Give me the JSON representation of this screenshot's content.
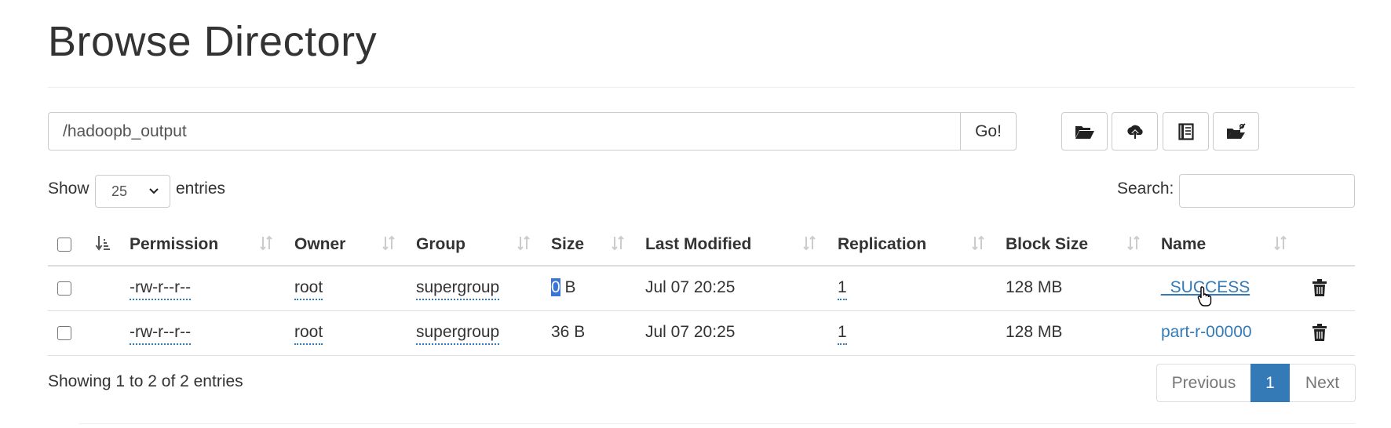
{
  "page": {
    "title": "Browse Directory"
  },
  "pathbar": {
    "value": "/hadoopb_output",
    "go_label": "Go!"
  },
  "toolbar": {
    "icons": [
      "folder-open-icon",
      "cloud-upload-icon",
      "book-icon",
      "cut-paste-icon"
    ]
  },
  "length": {
    "show_label": "Show",
    "selected": "25",
    "entries_label": "entries"
  },
  "search": {
    "label": "Search:",
    "value": ""
  },
  "table": {
    "headers": {
      "permission": "Permission",
      "owner": "Owner",
      "group": "Group",
      "size": "Size",
      "last_modified": "Last Modified",
      "replication": "Replication",
      "block_size": "Block Size",
      "name": "Name"
    },
    "rows": [
      {
        "permission": "-rw-r--r--",
        "owner": "root",
        "group": "supergroup",
        "size_num": "0",
        "size_unit": " B",
        "last_modified": "Jul 07 20:25",
        "replication": "1",
        "block_size": "128 MB",
        "name": "_SUCCESS"
      },
      {
        "permission": "-rw-r--r--",
        "owner": "root",
        "group": "supergroup",
        "size": "36 B",
        "last_modified": "Jul 07 20:25",
        "replication": "1",
        "block_size": "128 MB",
        "name": "part-r-00000"
      }
    ]
  },
  "footer": {
    "info": "Showing 1 to 2 of 2 entries",
    "pagination": {
      "previous": "Previous",
      "current": "1",
      "next": "Next"
    }
  },
  "colors": {
    "link": "#337ab7",
    "active_page": "#337ab7",
    "text_highlight": "#3875d7"
  }
}
